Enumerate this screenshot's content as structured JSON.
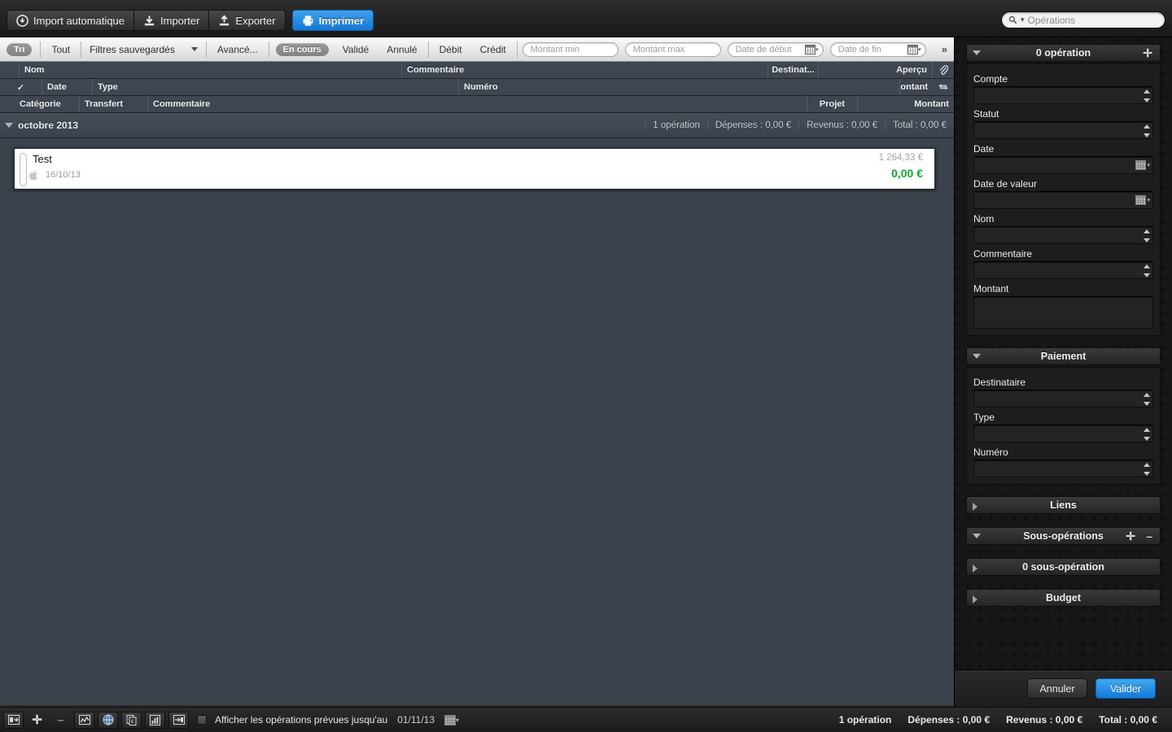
{
  "toolbar": {
    "buttons": [
      {
        "label": "Import automatique",
        "icon": "auto-import-icon"
      },
      {
        "label": "Importer",
        "icon": "download-icon"
      },
      {
        "label": "Exporter",
        "icon": "upload-icon"
      }
    ],
    "print_label": "Imprimer",
    "print_icon": "printer-icon",
    "search": {
      "placeholder": "Opérations",
      "icon": "search-icon"
    }
  },
  "filterbar": {
    "sort_pill": "Tri",
    "all_label": "Tout",
    "saved_filters_label": "Filtres sauvegardés",
    "advanced_label": "Avancé...",
    "status": [
      {
        "label": "En cours",
        "active": true
      },
      {
        "label": "Validé",
        "active": false
      },
      {
        "label": "Annulé",
        "active": false
      }
    ],
    "debit_label": "Débit",
    "credit_label": "Crédit",
    "amount_min_placeholder": "Montant min",
    "amount_max_placeholder": "Montant max",
    "date_start_placeholder": "Date de début",
    "date_end_placeholder": "Date de fin",
    "overflow_label": "»"
  },
  "columns": {
    "row1": [
      "Nom",
      "Commentaire",
      "Destinat...",
      "Aperçu"
    ],
    "row1_icon": "paperclip-icon",
    "row2": [
      "✓",
      "Date",
      "Type",
      "Numéro",
      "Montant"
    ],
    "row2_icon": "transfer-arrows-icon",
    "row3": [
      "Catégorie",
      "Transfert",
      "Commentaire",
      "Projet",
      "Montant"
    ]
  },
  "month_group": {
    "title": "octobre 2013",
    "count": "1 opération",
    "expenses": "Dépenses : 0,00 €",
    "revenue": "Revenus : 0,00 €",
    "total": "Total : 0,00 €"
  },
  "operation": {
    "name": "Test",
    "date": "16/10/13",
    "balance": "1 264,33 €",
    "amount": "0,00 €",
    "amount_color": "#0aaa2e",
    "status_icon": "apple-icon"
  },
  "right_panel": {
    "operation_group": {
      "title": "0 opération",
      "add_icon": "plus-icon",
      "fields": [
        {
          "label": "Compte",
          "value": "",
          "control": "stepper"
        },
        {
          "label": "Statut",
          "value": "",
          "control": "stepper"
        },
        {
          "label": "Date",
          "value": "",
          "control": "calendar"
        },
        {
          "label": "Date de valeur",
          "value": "",
          "control": "calendar"
        },
        {
          "label": "Nom",
          "value": "",
          "control": "stepper"
        },
        {
          "label": "Commentaire",
          "value": "",
          "control": "stepper"
        },
        {
          "label": "Montant",
          "value": "",
          "control": "none"
        }
      ]
    },
    "payment_group": {
      "title": "Paiement",
      "fields": [
        {
          "label": "Destinataire",
          "value": "",
          "control": "stepper"
        },
        {
          "label": "Type",
          "value": "",
          "control": "stepper"
        },
        {
          "label": "Numéro",
          "value": "",
          "control": "stepper"
        }
      ]
    },
    "links_group": {
      "title": "Liens"
    },
    "suboperations_group": {
      "title": "Sous-opérations",
      "add_icon": "plus-icon",
      "remove_icon": "minus-icon",
      "count_label": "0 sous-opération"
    },
    "budget_group": {
      "title": "Budget"
    },
    "cancel_label": "Annuler",
    "validate_label": "Valider"
  },
  "bottom_bar": {
    "icons": [
      "add-account-icon",
      "plus-icon",
      "minus-icon",
      "chart-icon",
      "globe-icon",
      "currency-doc-icon",
      "report-icon",
      "split-icon"
    ],
    "checkbox_label": "Afficher les opérations prévues jusqu'au",
    "date_value": "01/11/13",
    "calendar_icon": "calendar-icon",
    "status": {
      "count": "1 opération",
      "expenses": "Dépenses : 0,00 €",
      "revenue": "Revenus : 0,00 €",
      "total": "Total : 0,00 €"
    }
  }
}
